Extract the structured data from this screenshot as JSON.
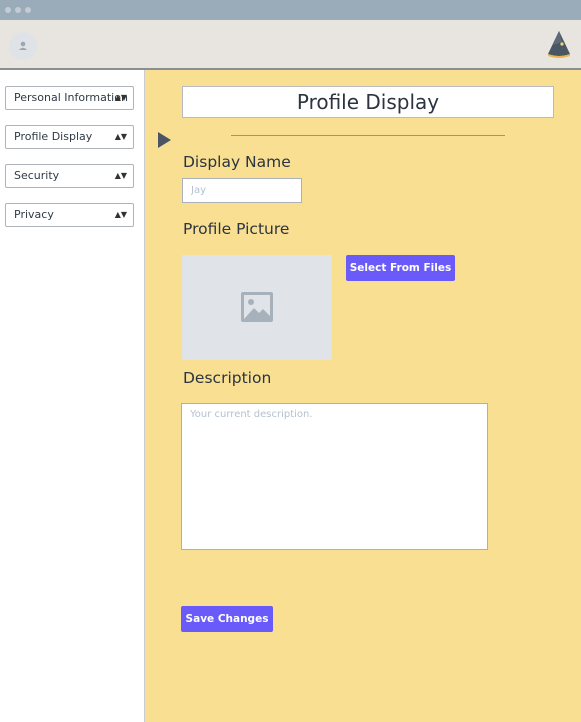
{
  "header": {
    "avatar_icon": "user-icon",
    "logo_icon": "wizard-hat-icon"
  },
  "sidebar": {
    "items": [
      {
        "label": "Personal Information"
      },
      {
        "label": "Profile Display"
      },
      {
        "label": "Security"
      },
      {
        "label": "Privacy"
      }
    ]
  },
  "main": {
    "title": "Profile Display",
    "display_name": {
      "label": "Display Name",
      "placeholder": "Jay"
    },
    "profile_picture": {
      "label": "Profile Picture",
      "placeholder_icon": "image-icon",
      "button": "Select From Files"
    },
    "description": {
      "label": "Description",
      "placeholder": "Your current description."
    },
    "save_button": "Save Changes"
  },
  "colors": {
    "main_bg": "#f9df92",
    "accent": "#6a5af9",
    "titlebar": "#9aabb9"
  }
}
